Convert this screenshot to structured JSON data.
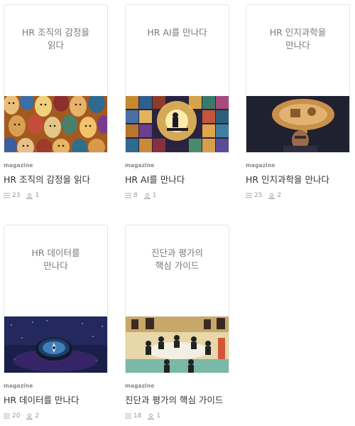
{
  "cards": [
    {
      "cover_title": "HR 조직의 감정을 읽다",
      "kind": "magazine",
      "title": "HR 조직의 감정을 읽다",
      "posts": "23",
      "subscribers": "1"
    },
    {
      "cover_title": "HR AI를 만나다",
      "kind": "magazine",
      "title": "HR AI를 만나다",
      "posts": "8",
      "subscribers": "1"
    },
    {
      "cover_title": "HR 인지과학을 만나다",
      "kind": "magazine",
      "title": "HR 인지과학을 만나다",
      "posts": "25",
      "subscribers": "2"
    },
    {
      "cover_title": "HR 데이터를 만나다",
      "kind": "magazine",
      "title": "HR 데이터를 만나다",
      "posts": "20",
      "subscribers": "2"
    },
    {
      "cover_title": "진단과 평가의 핵심 가이드",
      "kind": "magazine",
      "title": "진단과 평가의 핵심 가이드",
      "posts": "18",
      "subscribers": "1"
    }
  ],
  "icons": {
    "posts": "list-icon",
    "subscribers": "person-icon"
  },
  "colors": {
    "title": "#333333",
    "meta": "#9a9a9a",
    "cover_text": "#7a7a7a",
    "border": "#e6e6e6"
  }
}
